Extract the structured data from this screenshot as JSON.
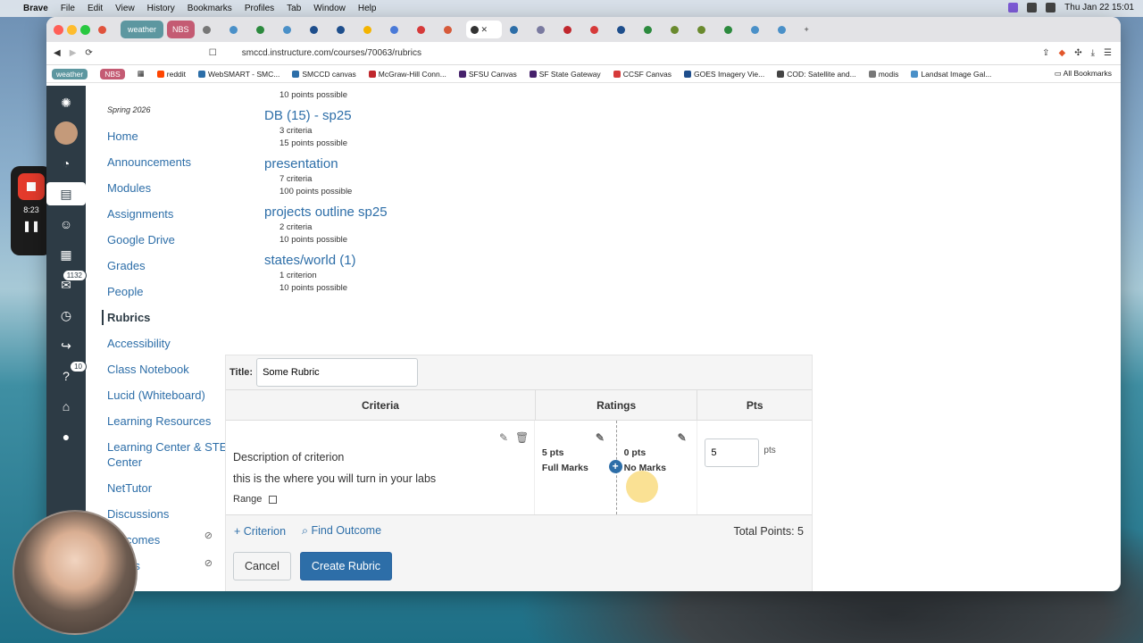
{
  "os_menubar": {
    "app": "Brave",
    "items": [
      "File",
      "Edit",
      "View",
      "History",
      "Bookmarks",
      "Profiles",
      "Tab",
      "Window",
      "Help"
    ],
    "clock": "Thu Jan 22  15:01"
  },
  "tabs": {
    "pill1": "weather",
    "pill2": "NBS"
  },
  "url": "smccd.instructure.com/courses/70063/rubrics",
  "bookmarks": [
    "weather",
    "NBS",
    "reddit",
    "WebSMART - SMC...",
    "SMCCD canvas",
    "McGraw-Hill Conn...",
    "SFSU Canvas",
    "SF State Gateway",
    "CCSF Canvas",
    "GOES Imagery Vie...",
    "COD: Satellite and...",
    "modis",
    "Landsat Image Gal..."
  ],
  "all_bookmarks": "All Bookmarks",
  "recorder": {
    "time": "8:23"
  },
  "global_nav": {
    "inbox_badge": "1132",
    "help_badge": "10"
  },
  "course_nav": {
    "term": "Spring 2026",
    "items": [
      "Home",
      "Announcements",
      "Modules",
      "Assignments",
      "Google Drive",
      "Grades",
      "People",
      "Rubrics",
      "Accessibility",
      "Class Notebook",
      "Lucid (Whiteboard)",
      "Learning Resources",
      "Learning Center & STEM Center",
      "NetTutor",
      "Discussions",
      "Outcomes",
      "Pages"
    ],
    "current": "Rubrics"
  },
  "rubrics": {
    "prev_points": "10 points possible",
    "list": [
      {
        "title": "DB (15) - sp25",
        "criteria": "3 criteria",
        "points": "15 points possible"
      },
      {
        "title": "presentation",
        "criteria": "7 criteria",
        "points": "100 points possible"
      },
      {
        "title": "projects outline sp25",
        "criteria": "2 criteria",
        "points": "10 points possible"
      },
      {
        "title": "states/world (1)",
        "criteria": "1 criterion",
        "points": "10 points possible"
      }
    ]
  },
  "editor": {
    "title_label": "Title:",
    "title_value": "Some Rubric",
    "headers": {
      "criteria": "Criteria",
      "ratings": "Ratings",
      "pts": "Pts"
    },
    "criterion": {
      "description": "Description of criterion",
      "long_description": "this is the where you will turn in your labs",
      "range_label": "Range"
    },
    "ratings": [
      {
        "pts": "5 pts",
        "label": "Full Marks"
      },
      {
        "pts": "0 pts",
        "label": "No Marks"
      }
    ],
    "pts_value": "5",
    "pts_unit": "pts",
    "add_criterion": "Criterion",
    "find_outcome": "Find Outcome",
    "total": "Total Points: 5",
    "cancel": "Cancel",
    "create": "Create Rubric"
  }
}
